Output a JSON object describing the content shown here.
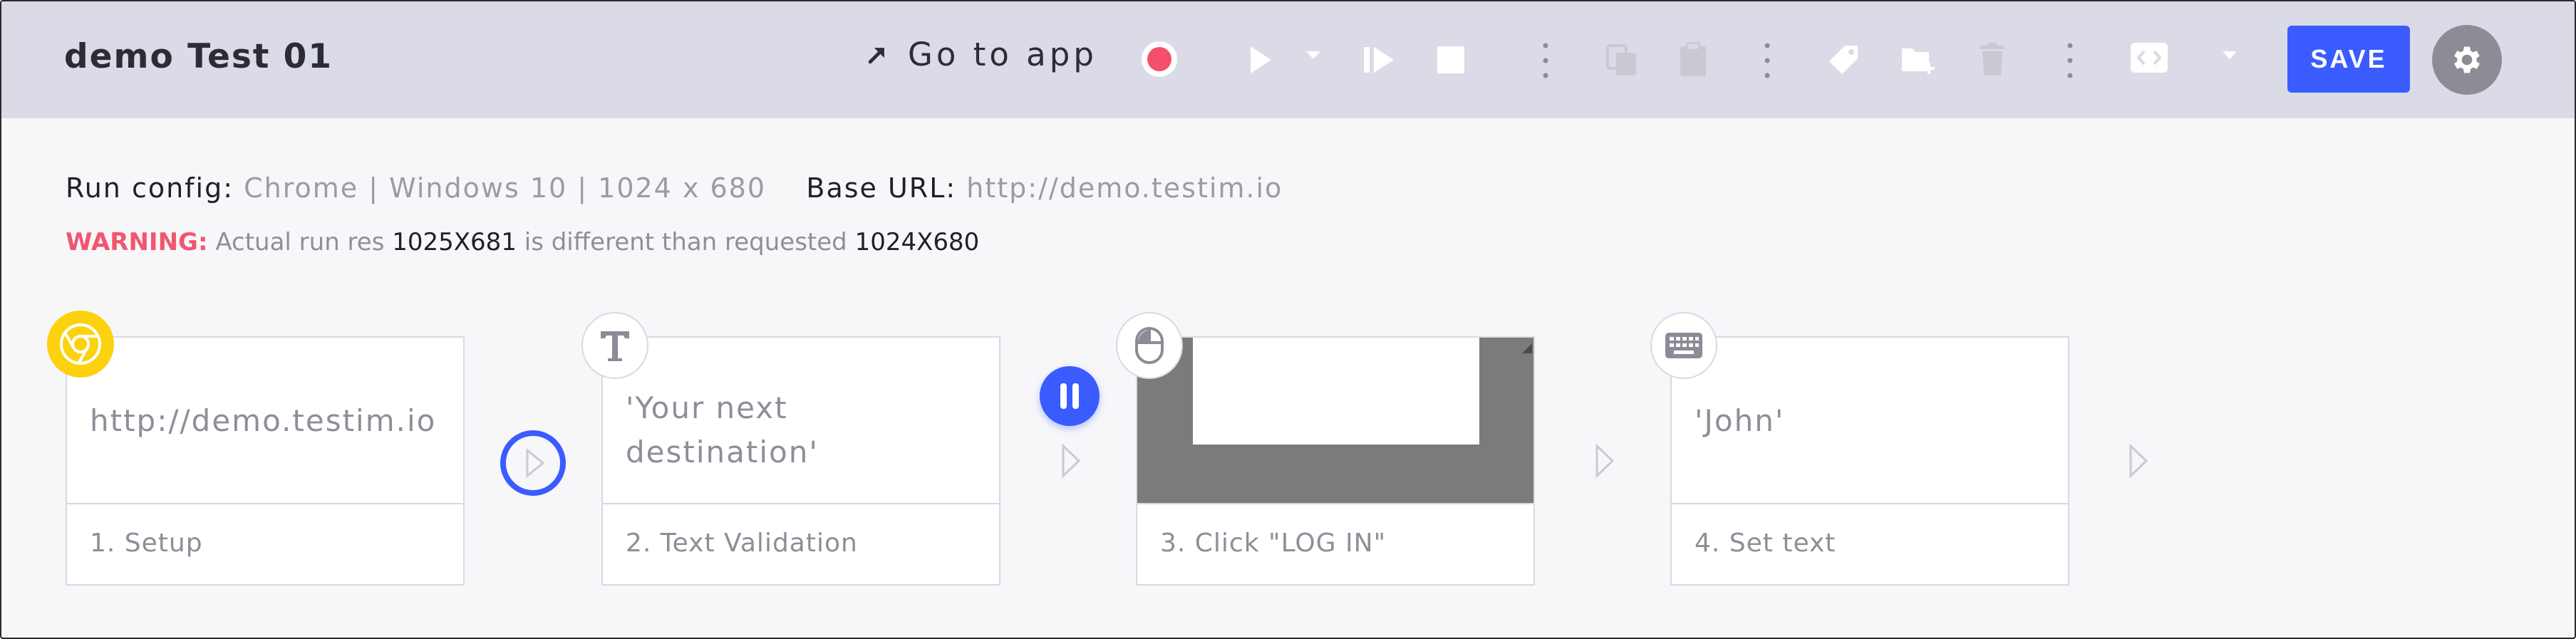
{
  "header": {
    "title": "demo Test 01",
    "go_to_app": "Go to app",
    "save_label": "SAVE"
  },
  "colors": {
    "header_bg": "#dadbe6",
    "accent": "#3a5cff",
    "record": "#f4506c",
    "warning": "#f2566e",
    "chrome_badge": "#fcd20f"
  },
  "toolbar_icons": [
    "arrow-up-right-icon",
    "record-icon",
    "play-icon",
    "chevron-down-icon",
    "step-forward-icon",
    "stop-icon",
    "more-vertical-icon",
    "copy-icon",
    "paste-icon",
    "more-vertical-icon",
    "tag-icon",
    "add-folder-icon",
    "trash-icon",
    "more-vertical-icon",
    "code-icon",
    "chevron-down-icon",
    "gear-icon"
  ],
  "run_config": {
    "label": "Run config:",
    "value": "Chrome | Windows 10 | 1024 x 680",
    "base_url_label": "Base URL:",
    "base_url": "http://demo.testim.io"
  },
  "warning": {
    "label": "WARNING:",
    "text1": " Actual run res ",
    "actual": "1025X681",
    "text2": " is different than requested ",
    "requested": "1024X680"
  },
  "steps": [
    {
      "name": "1. Setup",
      "content": "http://demo.testim.io",
      "icon": "chrome-icon"
    },
    {
      "name": "2. Text Validation",
      "content_line1": "'Your next",
      "content_line2": "destination'",
      "icon": "text-icon"
    },
    {
      "name": "3. Click \"LOG IN\"",
      "content": "",
      "icon": "mouse-icon"
    },
    {
      "name": "4. Set text",
      "content": "'John'",
      "icon": "keyboard-icon"
    }
  ]
}
